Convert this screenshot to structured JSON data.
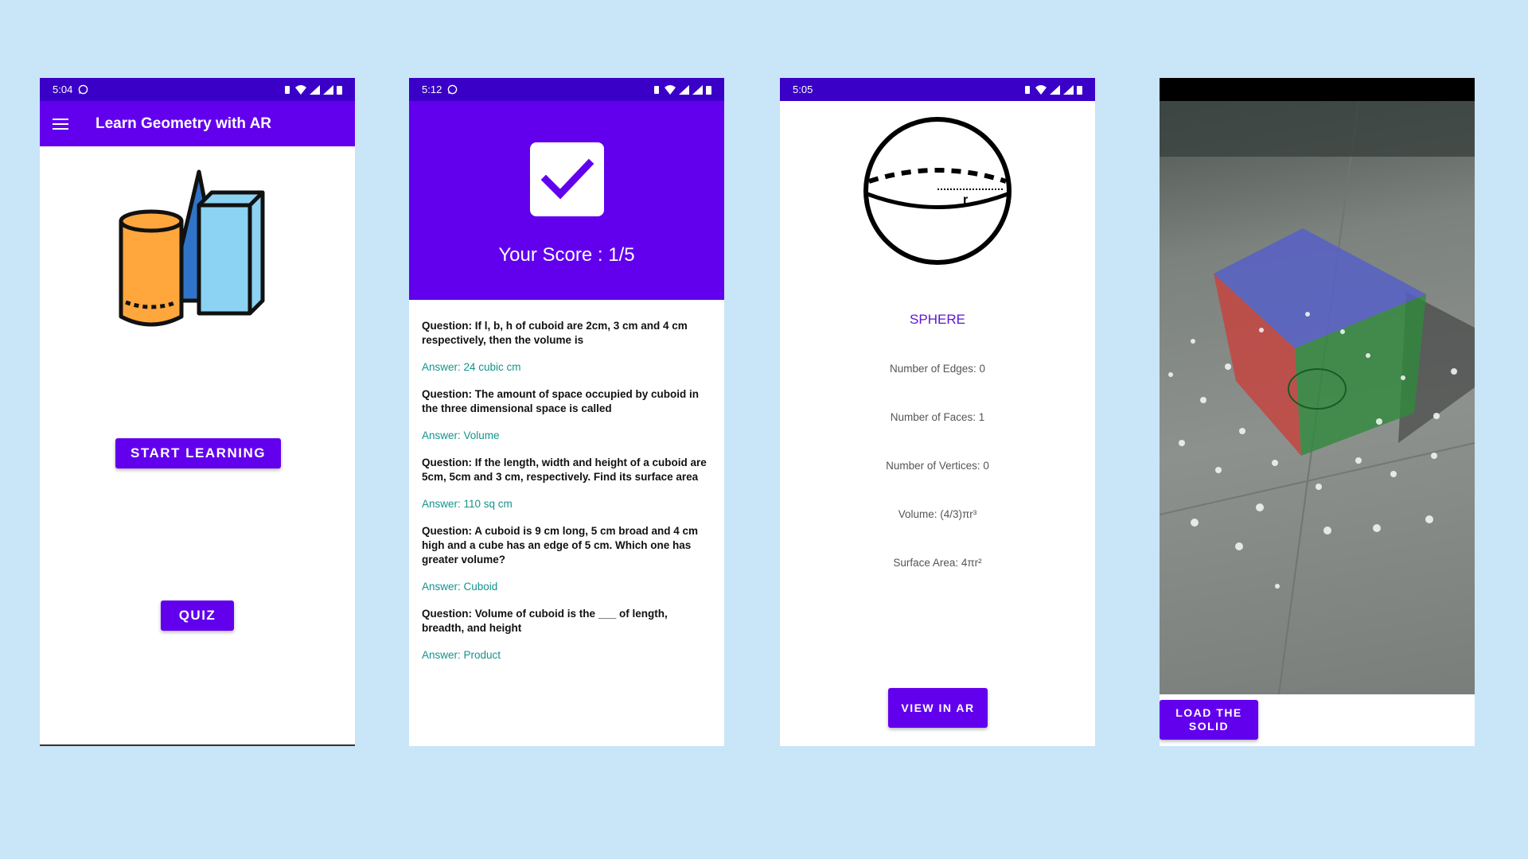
{
  "screens": {
    "home": {
      "status_time": "5:04",
      "title": "Learn Geometry with AR",
      "start_button": "START LEARNING",
      "quiz_button": "QUIZ"
    },
    "quiz_result": {
      "status_time": "5:12",
      "score_text": "Your Score : 1/5",
      "items": [
        {
          "question": "Question: If l, b, h of cuboid are 2cm, 3 cm and 4 cm respectively, then the volume is",
          "answer": "Answer: 24 cubic cm"
        },
        {
          "question": "Question: The amount of space occupied by cuboid in the three dimensional space is called",
          "answer": "Answer: Volume"
        },
        {
          "question": "Question: If the length, width and height of a cuboid are 5cm, 5cm and 3 cm, respectively. Find its surface area",
          "answer": "Answer: 110 sq cm"
        },
        {
          "question": "Question: A cuboid is 9 cm long, 5 cm broad and 4 cm high and a cube has an edge of 5 cm. Which one has greater volume?",
          "answer": "Answer: Cuboid"
        },
        {
          "question": "Question: Volume of cuboid is the ___ of length, breadth, and height",
          "answer": "Answer: Product"
        }
      ]
    },
    "shape_detail": {
      "status_time": "5:05",
      "radius_label": "r",
      "shape_name": "SPHERE",
      "edges": "Number of Edges: 0",
      "faces": "Number of Faces: 1",
      "vertices": "Number of Vertices: 0",
      "volume": "Volume: (4/3)πr³",
      "surface_area": "Surface Area: 4πr²",
      "view_ar_button": "VIEW IN AR"
    },
    "ar_view": {
      "load_button_line1": "LOAD THE",
      "load_button_line2": "SOLID"
    }
  },
  "colors": {
    "background": "#c9e5f8",
    "primary": "#6200ee",
    "status_bar": "#3a00c8",
    "answer_text": "#13938a",
    "shape_name": "#5b16d4"
  }
}
